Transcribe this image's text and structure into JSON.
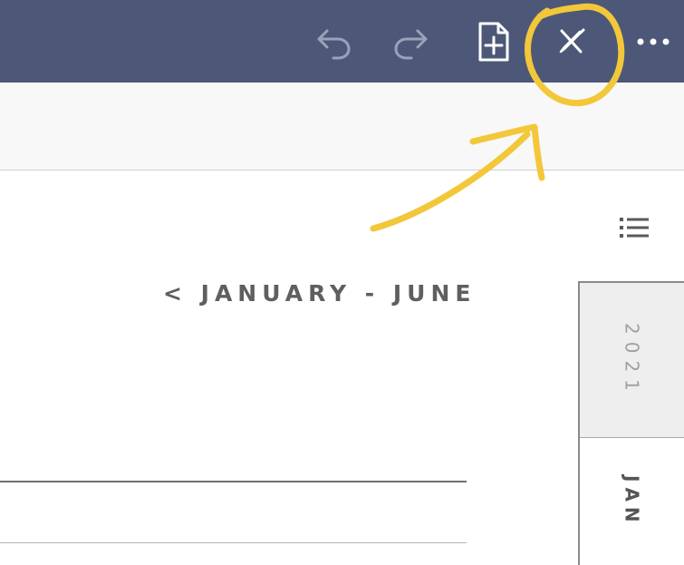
{
  "toolbar": {
    "background": "#4d5878",
    "icons": [
      {
        "name": "undo-icon"
      },
      {
        "name": "redo-icon"
      },
      {
        "name": "add-page-icon"
      },
      {
        "name": "pencil-off-icon"
      },
      {
        "name": "more-options-icon"
      }
    ]
  },
  "page": {
    "outline_icon": "list-icon",
    "range_title": "< JANUARY - JUNE",
    "side_tabs": [
      {
        "label": "2021"
      },
      {
        "label": "JAN"
      }
    ]
  },
  "annotation": {
    "color": "#f2c73a",
    "shapes": [
      "highlight-circle",
      "arrow"
    ]
  }
}
